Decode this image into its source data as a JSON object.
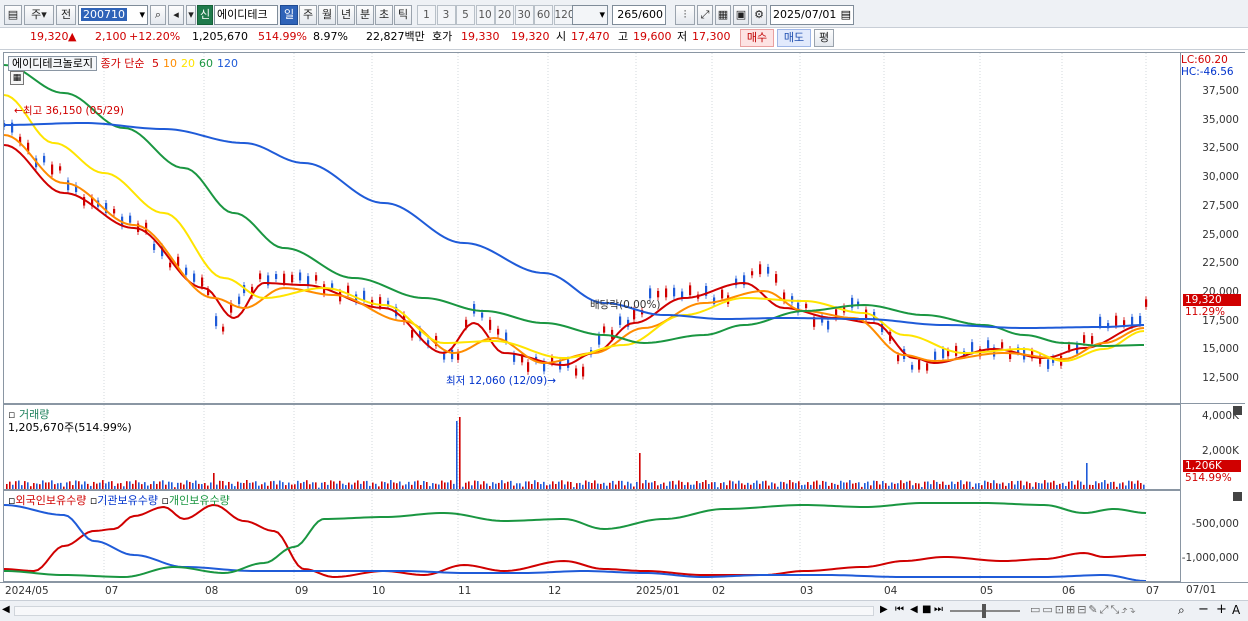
{
  "toolbar": {
    "period_unit": "주",
    "prev_label": "전",
    "code_value": "200710",
    "market_badge": "신",
    "stock_name": "에이디테크",
    "tabs": [
      "일",
      "주",
      "월",
      "년",
      "분",
      "초",
      "틱"
    ],
    "active_tab_index": 0,
    "periods": [
      "1",
      "3",
      "5",
      "10",
      "20",
      "30",
      "60",
      "120"
    ],
    "count_value": "265",
    "count_total": "/600",
    "date_value": "2025/07/01"
  },
  "quote": {
    "price": "19,320",
    "change_arrow": "▲",
    "change": "2,100",
    "change_pct": "+12.20%",
    "volume": "1,205,670",
    "volume_ratio": "514.99%",
    "turnover": "8.97%",
    "amount": "22,827백만",
    "ask_label": "호가",
    "ask1": "19,330",
    "ask2": "19,320",
    "open_label": "시",
    "open": "17,470",
    "high_label": "고",
    "high": "19,600",
    "low_label": "저",
    "low": "17,300",
    "buy_label": "매수",
    "sell_label": "매도",
    "avg_label": "평"
  },
  "price_pane": {
    "name_tab": "에이디테크놀로지",
    "legend_title": "종가 단순",
    "ma_labels": [
      "5",
      "10",
      "20",
      "60",
      "120"
    ],
    "ma_colors": [
      "#d00000",
      "#ff8c00",
      "#ffe400",
      "#1a9641",
      "#1f5bd8"
    ],
    "lc_label": "LC:60.20",
    "hc_label": "HC:-46.56",
    "max_annotation": "최고 36,150 (05/29)",
    "min_annotation": "최저 12,060 (12/09)",
    "dividend_annotation": "배당락(0.00%)",
    "current_price_tag": "19,320",
    "current_pct_tag": "11.29%",
    "y_ticks": [
      "37,500",
      "35,000",
      "32,500",
      "30,000",
      "27,500",
      "25,000",
      "22,500",
      "20,000",
      "17,500",
      "15,000",
      "12,500"
    ]
  },
  "volume_pane": {
    "title": "거래량",
    "value_label": "1,205,670주(514.99%)",
    "y_ticks": [
      "4,000K",
      "2,000K"
    ],
    "current_tag": "1,206K",
    "current_pct_tag": "514.99%"
  },
  "holdings_pane": {
    "legend": [
      "외국인보유수량",
      "기관보유수량",
      "개인보유수량"
    ],
    "legend_colors": [
      "#d00000",
      "#1f5bd8",
      "#1a9641"
    ],
    "y_ticks": [
      "-500,000",
      "-1,000,000"
    ]
  },
  "x_axis": {
    "labels": [
      "2024/05",
      "07",
      "08",
      "09",
      "10",
      "11",
      "12",
      "2025/01",
      "02",
      "03",
      "04",
      "05",
      "06",
      "07"
    ],
    "right_label": "07/01"
  },
  "bottom_bar": {
    "icons": [
      "scroll-left-icon",
      "first-icon",
      "prev-icon",
      "stop-icon",
      "next-icon",
      "zoom-slider",
      "search-icon",
      "zoom-out-icon",
      "zoom-in-icon"
    ]
  },
  "chart_data": {
    "type": "candlestick",
    "series": [
      {
        "name": "5",
        "values": []
      },
      {
        "name": "10",
        "values": []
      },
      {
        "name": "20",
        "values": []
      },
      {
        "name": "60",
        "values": []
      },
      {
        "name": "120",
        "values": []
      }
    ],
    "ylim": [
      11000,
      39000
    ],
    "max": {
      "value": 36150,
      "date": "05/29"
    },
    "min": {
      "value": 12060,
      "date": "12/09"
    },
    "last_close": 19320
  }
}
